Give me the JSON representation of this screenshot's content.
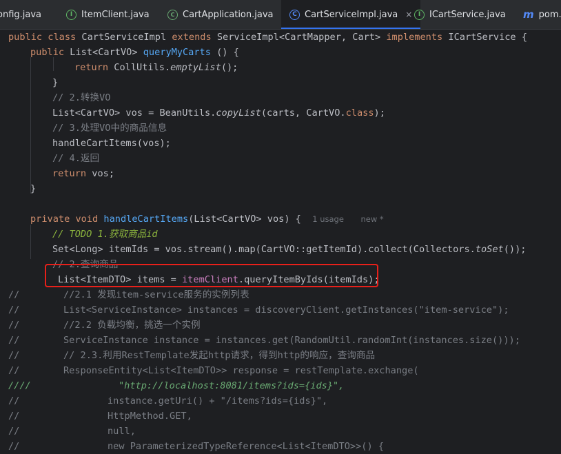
{
  "tabs": [
    {
      "name": "onfig.java",
      "icon": "java-class-icon"
    },
    {
      "name": "ItemClient.java",
      "icon": "java-interface-icon"
    },
    {
      "name": "CartApplication.java",
      "icon": "spring-boot-icon"
    },
    {
      "name": "CartServiceImpl.java",
      "icon": "java-class-icon",
      "active": true,
      "close": "×"
    },
    {
      "name": "ICartService.java",
      "icon": "java-interface-icon"
    },
    {
      "name": "pom.x",
      "icon": "maven-icon"
    }
  ],
  "code": {
    "kw_public": "public",
    "kw_class": "class",
    "class_name": "CartServiceImpl",
    "kw_extends": "extends",
    "super_type": "ServiceImpl<CartMapper, Cart>",
    "kw_implements": "implements",
    "interface_name": "ICartService",
    "open_brace": "{",
    "method1_return": "List<CartVO>",
    "method1_name": "queryMyCarts",
    "method1_params": "() {",
    "kw_return": "return",
    "empty_list_prefix": "CollUtils.",
    "empty_list_call": "emptyList",
    "empty_list_suffix": "();",
    "close_brace": "}",
    "comment_convert": "// 2.转换VO",
    "copy_prefix": "List<CartVO> vos = BeanUtils.",
    "copy_call": "copyList",
    "copy_args": "(carts, CartVO.",
    "kw_class_ref": "class",
    "copy_end": ");",
    "comment_handle": "// 3.处理VO中的商品信息",
    "handle_call": "handleCartItems(vos);",
    "comment_return": "// 4.返回",
    "return_value": "vos;",
    "kw_private": "private",
    "kw_void": "void",
    "method2_name": "handleCartItems",
    "method2_params": "(List<CartVO> vos) {",
    "usage_hint": "1 usage",
    "new_hint": "new *",
    "todo_comment": "// TODO 1.获取商品id",
    "item_ids_prefix": "Set<Long> itemIds = vos.stream().map(CartVO::getItemId).collect(Collectors.",
    "to_set_call": "toSet",
    "item_ids_suffix": "());",
    "comment_query": "// 2.查询商品",
    "items_decl": "List<ItemDTO> items = ",
    "item_client_field": "itemClient",
    "items_call": ".queryItemByIds(itemIds);",
    "commented": {
      "c1_prefix": "//",
      "c1_text": "//2.1 发现item-service服务的实例列表",
      "c2_prefix": "//",
      "c2_text": "List<ServiceInstance> instances = discoveryClient.getInstances(\"item-service\");",
      "c3_prefix": "//",
      "c3_text": "//2.2 负载均衡，挑选一个实例",
      "c4_prefix": "//",
      "c4_text": "ServiceInstance instance = instances.get(RandomUtil.randomInt(instances.size()));",
      "c5_prefix": "//",
      "c5_text": "// 2.3.利用RestTemplate发起http请求，得到http的响应，查询商品",
      "c6_prefix": "//",
      "c6_text": "ResponseEntity<List<ItemDTO>> response = restTemplate.exchange(",
      "c7_prefix": "////",
      "c7_text": "\"http://localhost:8081/items?ids={ids}\",",
      "c8_prefix": "//",
      "c8_text": "instance.getUri() + \"/items?ids={ids}\",",
      "c9_prefix": "//",
      "c9_text": "HttpMethod.GET,",
      "c10_prefix": "//",
      "c10_text": "null,",
      "c11_prefix": "//",
      "c11_text": "new ParameterizedTypeReference<List<ItemDTO>>() {"
    }
  },
  "colors": {
    "background": "#1e1f22",
    "keyword": "#cf8e6d",
    "method": "#56a8f5",
    "field": "#c77dbb",
    "comment": "#7a7e85",
    "todo": "#8bb33d",
    "string": "#6aab73",
    "highlight_box": "#e8201a",
    "active_tab_underline": "#3574f0"
  }
}
